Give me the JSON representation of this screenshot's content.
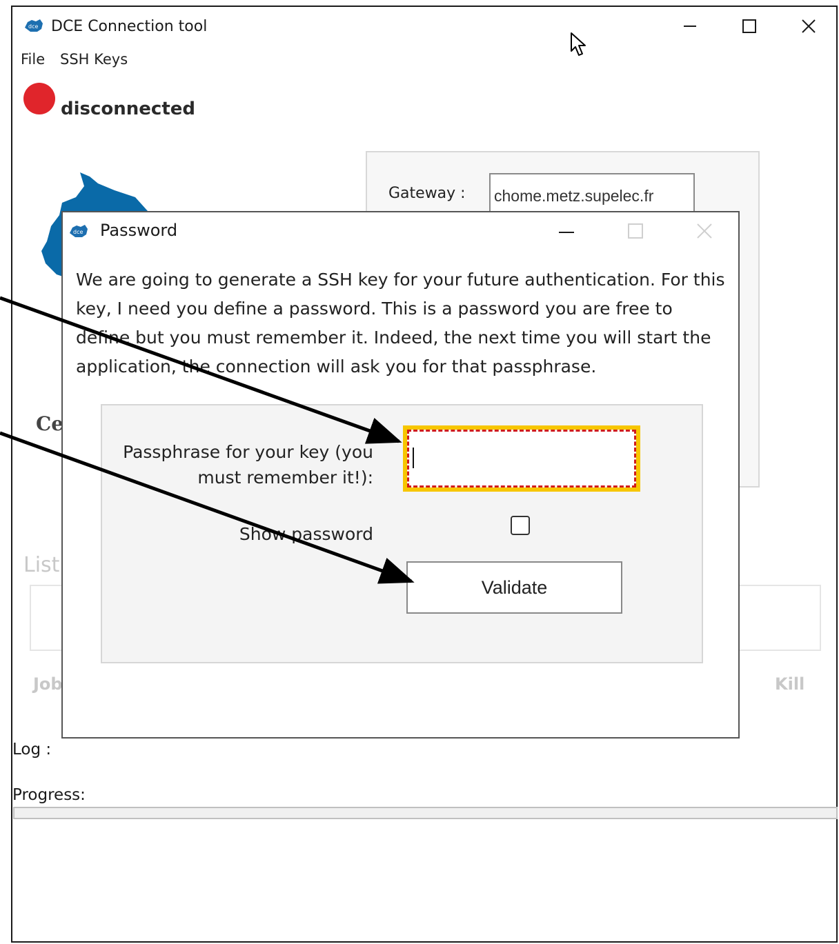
{
  "window": {
    "title": "DCE Connection tool",
    "menu": [
      "File",
      "SSH Keys"
    ]
  },
  "status": {
    "text": "disconnected",
    "color": "#e0252b"
  },
  "gateway": {
    "label": "Gateway :",
    "value": "chome.metz.supelec.fr"
  },
  "partial": {
    "ce": "Ce",
    "list": "List",
    "job": "Job",
    "kill": "Kill"
  },
  "log": {
    "label": "Log :"
  },
  "progress": {
    "label": "Progress:",
    "value": 0
  },
  "dialog": {
    "title": "Password",
    "message": "We are going to generate a SSH key for your future authentication. For this key, I need you define a password. This is a password you are free to define but you must remember it. Indeed, the next time you will start the application, the connection will ask you for that passphrase.",
    "passphrase_label": "Passphrase for your key (you must remember it!):",
    "passphrase_value": "",
    "show_password_label": "Show password",
    "show_password_checked": false,
    "validate_label": "Validate"
  },
  "colors": {
    "highlight_outline": "#f7c600",
    "highlight_dash": "#d01c1c",
    "accent": "#0a6aa8"
  }
}
